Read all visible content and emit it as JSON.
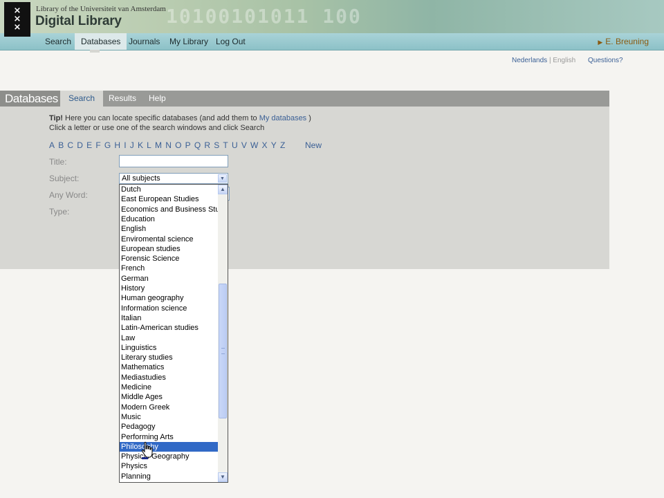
{
  "header": {
    "subtitle": "Library of the Universiteit van Amsterdam",
    "title": "Digital Library",
    "decoration": "10100101011 100"
  },
  "nav": {
    "items": [
      "Search",
      "Databases",
      "Journals",
      "My Library",
      "Log Out"
    ],
    "active": "Databases",
    "user": "E. Breuning"
  },
  "lang": {
    "nl": "Nederlands",
    "sep": "|",
    "en": "English",
    "questions": "Questions?"
  },
  "panel": {
    "title": "Databases",
    "tabs": [
      "Search",
      "Results",
      "Help"
    ],
    "active_tab": "Search",
    "tip": {
      "bold": "Tip!",
      "line1_a": " Here you can locate specific databases (and add them to ",
      "link": "My databases",
      "line1_b": " )",
      "line2": "Click a letter or use one of the search windows and click Search"
    },
    "letters": [
      "A",
      "B",
      "C",
      "D",
      "E",
      "F",
      "G",
      "H",
      "I",
      "J",
      "K",
      "L",
      "M",
      "N",
      "O",
      "P",
      "Q",
      "R",
      "S",
      "T",
      "U",
      "V",
      "W",
      "X",
      "Y",
      "Z"
    ],
    "new_label": "New",
    "labels": {
      "title": "Title:",
      "subject": "Subject:",
      "any_word": "Any Word:",
      "type": "Type:"
    },
    "title_value": "",
    "subject_selected": "All subjects",
    "subject_options": [
      "Dutch",
      "East European Studies",
      "Economics and Business Studies",
      "Education",
      "English",
      "Enviromental science",
      "European studies",
      "Forensic Science",
      "French",
      "German",
      "History",
      "Human geography",
      "Information science",
      "Italian",
      "Latin-American studies",
      "Law",
      "Linguistics",
      "Literary studies",
      "Mathematics",
      "Mediastudies",
      "Medicine",
      "Middle Ages",
      "Modern Greek",
      "Music",
      "Pedagogy",
      "Performing Arts",
      "Philosophy",
      "Physical Geography",
      "Physics",
      "Planning"
    ],
    "highlighted_option": "Philosophy",
    "colors": {
      "accent": "#3a5f95",
      "highlight": "#3169c6",
      "user": "#8a5a10"
    }
  }
}
